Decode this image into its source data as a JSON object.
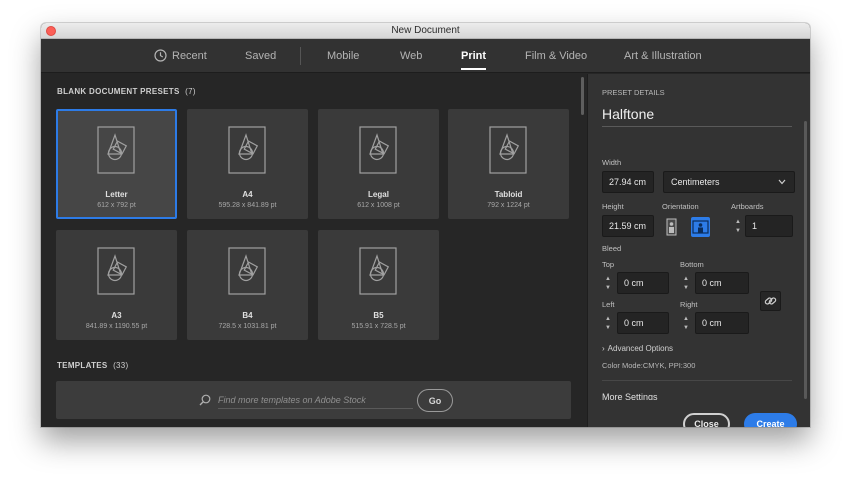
{
  "window": {
    "title": "New Document"
  },
  "tabs": [
    {
      "label": "Recent",
      "active": false,
      "icon": "clock-icon"
    },
    {
      "label": "Saved",
      "active": false
    },
    {
      "label": "Mobile",
      "active": false
    },
    {
      "label": "Web",
      "active": false
    },
    {
      "label": "Print",
      "active": true
    },
    {
      "label": "Film & Video",
      "active": false
    },
    {
      "label": "Art & Illustration",
      "active": false
    }
  ],
  "presets": {
    "title": "BLANK DOCUMENT PRESETS",
    "count": "(7)",
    "items": [
      {
        "name": "Letter",
        "size": "612 x 792 pt",
        "selected": true
      },
      {
        "name": "A4",
        "size": "595.28 x 841.89 pt",
        "selected": false
      },
      {
        "name": "Legal",
        "size": "612 x 1008 pt",
        "selected": false
      },
      {
        "name": "Tabloid",
        "size": "792 x 1224 pt",
        "selected": false
      },
      {
        "name": "A3",
        "size": "841.89 x 1190.55 pt",
        "selected": false
      },
      {
        "name": "B4",
        "size": "728.5 x 1031.81 pt",
        "selected": false
      },
      {
        "name": "B5",
        "size": "515.91 x 728.5 pt",
        "selected": false
      }
    ]
  },
  "templates": {
    "title": "TEMPLATES",
    "count": "(33)",
    "search_placeholder": "Find more templates on Adobe Stock",
    "go_label": "Go"
  },
  "details": {
    "section_title": "PRESET DETAILS",
    "preset_name": "Halftone",
    "width_label": "Width",
    "width_value": "27.94 cm",
    "units_value": "Centimeters",
    "height_label": "Height",
    "height_value": "21.59 cm",
    "orientation_label": "Orientation",
    "orientation_selected": "landscape",
    "artboards_label": "Artboards",
    "artboards_value": "1",
    "bleed_label": "Bleed",
    "bleed_top_label": "Top",
    "bleed_top_value": "0 cm",
    "bleed_bottom_label": "Bottom",
    "bleed_bottom_value": "0 cm",
    "bleed_left_label": "Left",
    "bleed_left_value": "0 cm",
    "bleed_right_label": "Right",
    "bleed_right_value": "0 cm",
    "advanced_label": "Advanced Options",
    "color_mode": "Color Mode:CMYK, PPI:300",
    "more_settings_label": "More Settings",
    "close_label": "Close",
    "create_label": "Create"
  },
  "colors": {
    "accent": "#2d7ce8",
    "panel_bg": "#262626",
    "details_bg": "#333333"
  }
}
